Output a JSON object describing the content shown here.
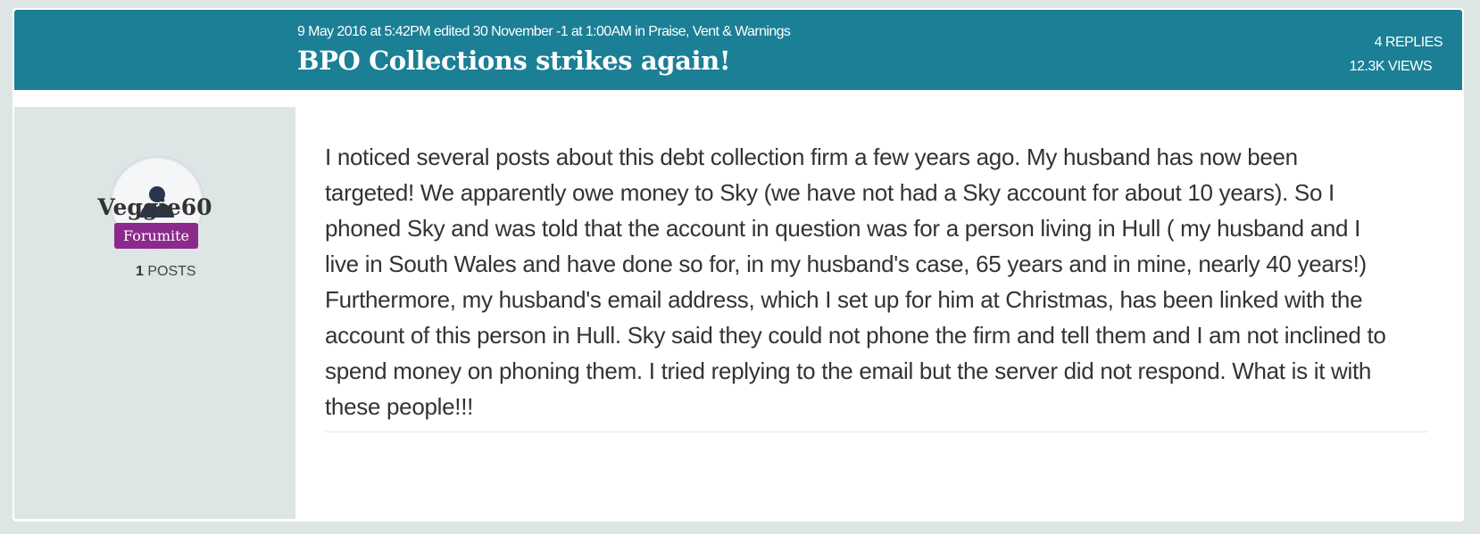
{
  "discussion": {
    "meta": "9 May 2016 at 5:42PM edited 30 November -1 at 1:00AM in Praise, Vent & Warnings",
    "title": "BPO Collections strikes again!",
    "replies": "4 REPLIES",
    "views": "12.3K VIEWS"
  },
  "author": {
    "avatar_icon": "user-silhouette-icon",
    "name": "Veggie60",
    "badge": "Forumite",
    "posts_count": "1",
    "posts_label": "POSTS"
  },
  "post": {
    "body": "I noticed several posts about this debt collection firm a few years ago. My husband has now been targeted! We apparently owe money to Sky (we have not had a Sky account for about 10 years). So I phoned Sky and was told that the account in question was for a person living in Hull ( my husband and I live in South Wales and have done so for, in my husband's case, 65 years and in mine, nearly 40 years!) Furthermore, my husband's email address, which I set up for him at Christmas, has been linked with the account of this person in Hull. Sky said they could not phone the firm and tell them and I am not inclined to spend money on phoning them. I tried replying to the email but the server did not respond. What is it with these people!!!"
  },
  "colors": {
    "header": "#1b7f96",
    "badge": "#8b2a8c",
    "background": "#dde5e5"
  }
}
